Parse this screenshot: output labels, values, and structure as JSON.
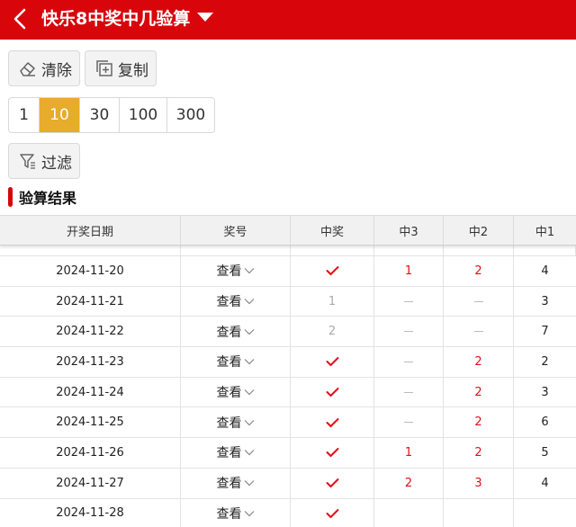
{
  "header": {
    "title": "快乐8中奖中几验算",
    "back_icon": "chevron-left-icon",
    "caret_icon": "caret-down-icon"
  },
  "toolbar": {
    "clear_label": "清除",
    "clear_icon": "eraser-icon",
    "copy_label": "复制",
    "copy_icon": "copy-icon"
  },
  "period_options": [
    "1",
    "10",
    "30",
    "100",
    "300"
  ],
  "period_selected": "10",
  "filter": {
    "label": "过滤",
    "icon": "filter-icon"
  },
  "section": {
    "title": "验算结果"
  },
  "table": {
    "headers": [
      "开奖日期",
      "奖号",
      "中奖",
      "中3",
      "中2",
      "中1"
    ],
    "rows": [
      {
        "date": "2024-11-20",
        "view": "查看",
        "win": "check",
        "m3": "1",
        "m2": "2",
        "m1": "4"
      },
      {
        "date": "2024-11-21",
        "view": "查看",
        "win": "1",
        "m3": "-",
        "m2": "-",
        "m1": "3"
      },
      {
        "date": "2024-11-22",
        "view": "查看",
        "win": "2",
        "m3": "-",
        "m2": "-",
        "m1": "7"
      },
      {
        "date": "2024-11-23",
        "view": "查看",
        "win": "check",
        "m3": "-",
        "m2": "2",
        "m1": "2"
      },
      {
        "date": "2024-11-24",
        "view": "查看",
        "win": "check",
        "m3": "-",
        "m2": "2",
        "m1": "3"
      },
      {
        "date": "2024-11-25",
        "view": "查看",
        "win": "check",
        "m3": "-",
        "m2": "2",
        "m1": "6"
      },
      {
        "date": "2024-11-26",
        "view": "查看",
        "win": "check",
        "m3": "1",
        "m2": "2",
        "m1": "5"
      },
      {
        "date": "2024-11-27",
        "view": "查看",
        "win": "check",
        "m3": "2",
        "m2": "3",
        "m1": "4"
      },
      {
        "date": "2024-11-28",
        "view": "查看",
        "win": "check",
        "m3": "",
        "m2": "",
        "m1": ""
      }
    ]
  },
  "colors": {
    "brand_red": "#d8060b",
    "active_gold": "#e7ac2b",
    "value_red": "#e00f17"
  }
}
